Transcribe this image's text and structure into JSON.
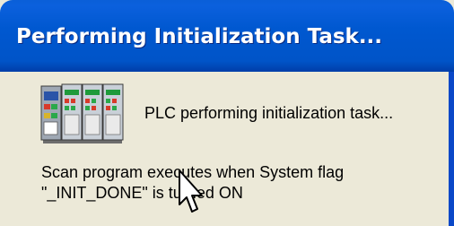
{
  "window": {
    "title": "Performing Initialization Task..."
  },
  "status": {
    "text": "PLC performing initialization task..."
  },
  "message": {
    "line1": "Scan program executes when System flag",
    "line2": "\"_INIT_DONE\" is turned ON"
  },
  "icons": {
    "plc": "plc-rack-icon",
    "cursor": "mouse-pointer-icon"
  },
  "colors": {
    "title_bar": "#0054c8",
    "title_text": "#ffffff",
    "dialog_background": "#ece9d8"
  }
}
